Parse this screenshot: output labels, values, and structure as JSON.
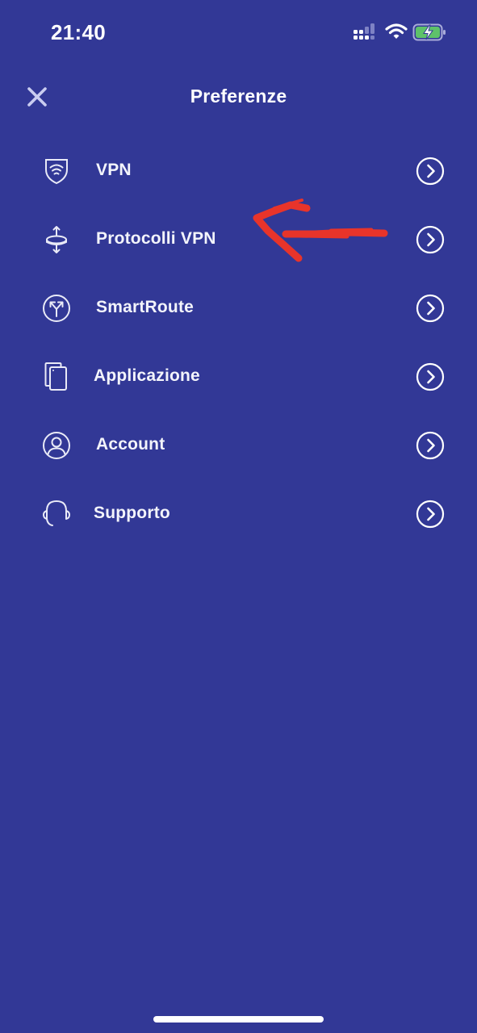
{
  "status_bar": {
    "time": "21:40",
    "icons": [
      "signal-icon",
      "wifi-icon",
      "battery-charging-icon"
    ],
    "battery_color": "#5ec26a"
  },
  "header": {
    "title": "Preferenze",
    "close_icon": "close-icon"
  },
  "menu": {
    "items": [
      {
        "label": "VPN",
        "icon": "shield-wifi-icon"
      },
      {
        "label": "Protocolli VPN",
        "icon": "protocols-icon"
      },
      {
        "label": "SmartRoute",
        "icon": "route-split-icon"
      },
      {
        "label": "Applicazione",
        "icon": "device-icon"
      },
      {
        "label": "Account",
        "icon": "user-circle-icon"
      },
      {
        "label": "Supporto",
        "icon": "headset-icon"
      }
    ]
  },
  "colors": {
    "background": "#323896",
    "text": "#ffffff",
    "close_icon": "#c9ccf0",
    "annotation": "#e8342a"
  }
}
